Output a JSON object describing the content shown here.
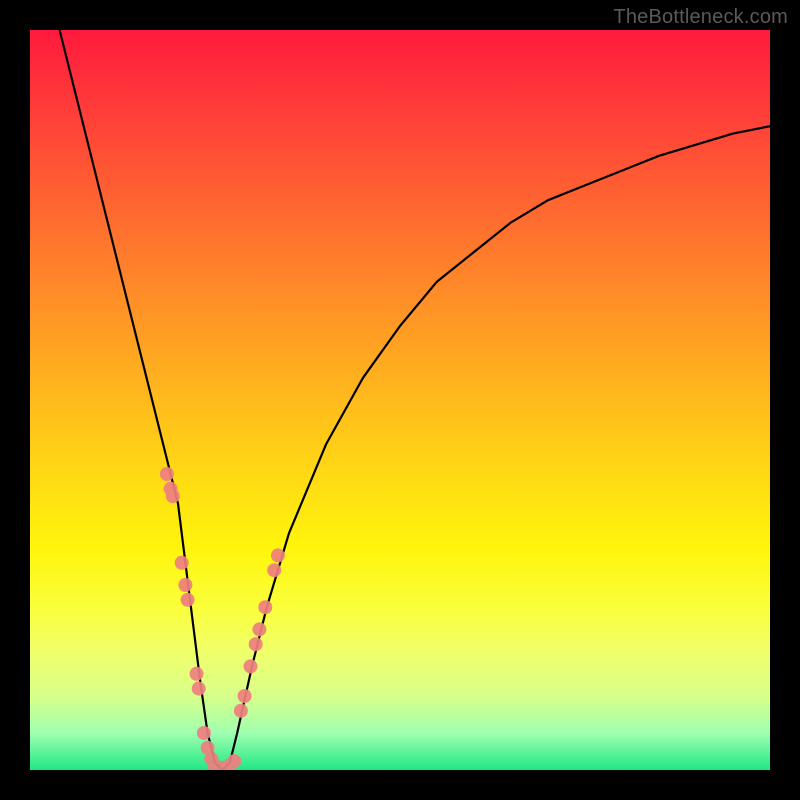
{
  "watermark": "TheBottleneck.com",
  "chart_data": {
    "type": "line",
    "title": "",
    "xlabel": "",
    "ylabel": "",
    "xlim": [
      0,
      100
    ],
    "ylim": [
      0,
      100
    ],
    "grid": false,
    "background_gradient": {
      "top_color": "#ff1a3c",
      "mid_color": "#fff50c",
      "bottom_color": "#20e884",
      "meaning": "red=high bottleneck, green=low bottleneck"
    },
    "series": [
      {
        "name": "bottleneck-curve",
        "type": "line",
        "color": "#000000",
        "x": [
          4,
          6,
          8,
          10,
          12,
          14,
          16,
          18,
          20,
          22,
          23,
          24,
          25,
          26,
          27,
          28,
          30,
          32,
          35,
          40,
          45,
          50,
          55,
          60,
          65,
          70,
          75,
          80,
          85,
          90,
          95,
          100
        ],
        "y": [
          100,
          92,
          84,
          76,
          68,
          60,
          52,
          44,
          36,
          20,
          12,
          5,
          1,
          0,
          1,
          5,
          14,
          22,
          32,
          44,
          53,
          60,
          66,
          70,
          74,
          77,
          79,
          81,
          83,
          84.5,
          86,
          87
        ]
      },
      {
        "name": "data-points-left",
        "type": "scatter",
        "color": "#f08080",
        "x": [
          18.5,
          19.0,
          19.3,
          20.5,
          21.0,
          21.3,
          22.5,
          22.8,
          23.5,
          24.0,
          24.5
        ],
        "y": [
          40,
          38,
          37,
          28,
          25,
          23,
          13,
          11,
          5,
          3,
          1.5
        ]
      },
      {
        "name": "data-points-bottom",
        "type": "scatter",
        "color": "#f08080",
        "x": [
          25.0,
          25.6,
          26.3,
          27.0,
          27.6
        ],
        "y": [
          0.5,
          0.3,
          0.3,
          0.6,
          1.2
        ]
      },
      {
        "name": "data-points-right",
        "type": "scatter",
        "color": "#f08080",
        "x": [
          28.5,
          29.0,
          29.8,
          30.5,
          31.0,
          31.8,
          33.0,
          33.5
        ],
        "y": [
          8,
          10,
          14,
          17,
          19,
          22,
          27,
          29
        ]
      }
    ],
    "minimum_point": {
      "x": 26,
      "y": 0
    }
  }
}
